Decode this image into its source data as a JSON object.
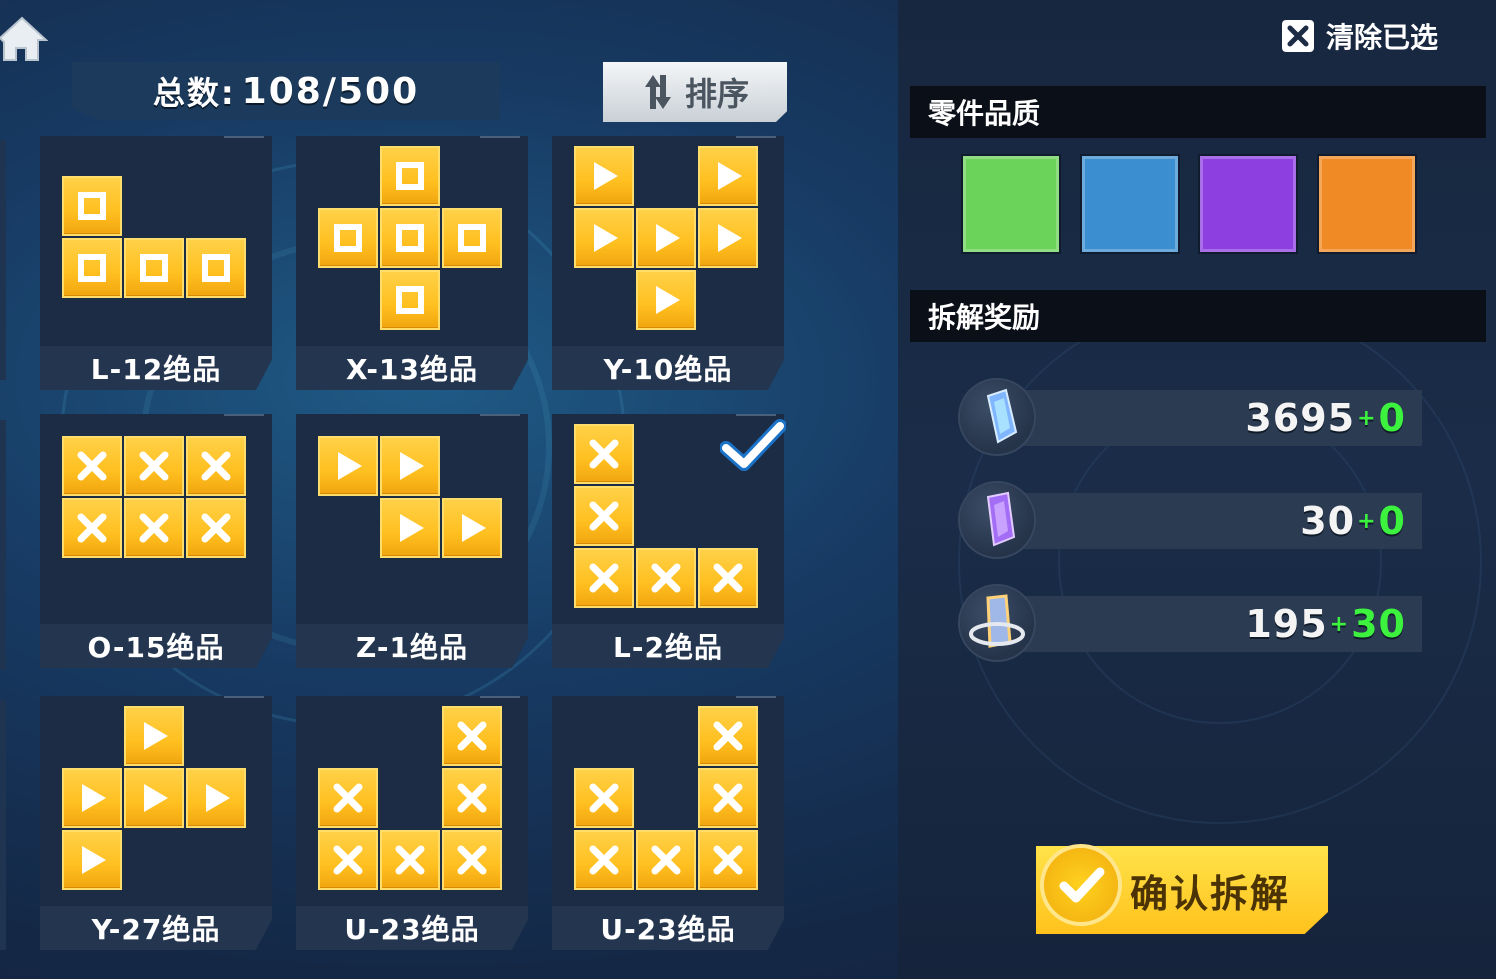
{
  "header": {
    "count_label": "总数:",
    "count_value": "108/500",
    "sort_label": "排序"
  },
  "cards": [
    {
      "name": "L-12绝品",
      "shape": "L12",
      "symbol": "square",
      "selected": false
    },
    {
      "name": "X-13绝品",
      "shape": "X13",
      "symbol": "square",
      "selected": false
    },
    {
      "name": "Y-10绝品",
      "shape": "Y10",
      "symbol": "triangle",
      "selected": false
    },
    {
      "name": "O-15绝品",
      "shape": "O15",
      "symbol": "cross",
      "selected": false
    },
    {
      "name": "Z-1绝品",
      "shape": "Z1",
      "symbol": "triangle",
      "selected": false
    },
    {
      "name": "L-2绝品",
      "shape": "L2",
      "symbol": "cross",
      "selected": true
    },
    {
      "name": "Y-27绝品",
      "shape": "Y27",
      "symbol": "triangle",
      "selected": false
    },
    {
      "name": "U-23绝品",
      "shape": "U23",
      "symbol": "cross",
      "selected": false
    },
    {
      "name": "U-23绝品",
      "shape": "U23",
      "symbol": "cross",
      "selected": false
    }
  ],
  "right": {
    "clear_label": "清除已选",
    "quality_title": "零件品质",
    "quality_colors": [
      "#6bd25a",
      "#3b8fd0",
      "#8d3fe0",
      "#f08a24"
    ],
    "reward_title": "拆解奖励",
    "rewards": [
      {
        "icon": "blue-crystal-icon",
        "value": "3695",
        "plus": "+",
        "add": "0"
      },
      {
        "icon": "purple-crystal-icon",
        "value": "30",
        "plus": "+",
        "add": "0"
      },
      {
        "icon": "gold-crystal-icon",
        "value": "195",
        "plus": "+",
        "add": "30"
      }
    ],
    "confirm_label": "确认拆解"
  }
}
